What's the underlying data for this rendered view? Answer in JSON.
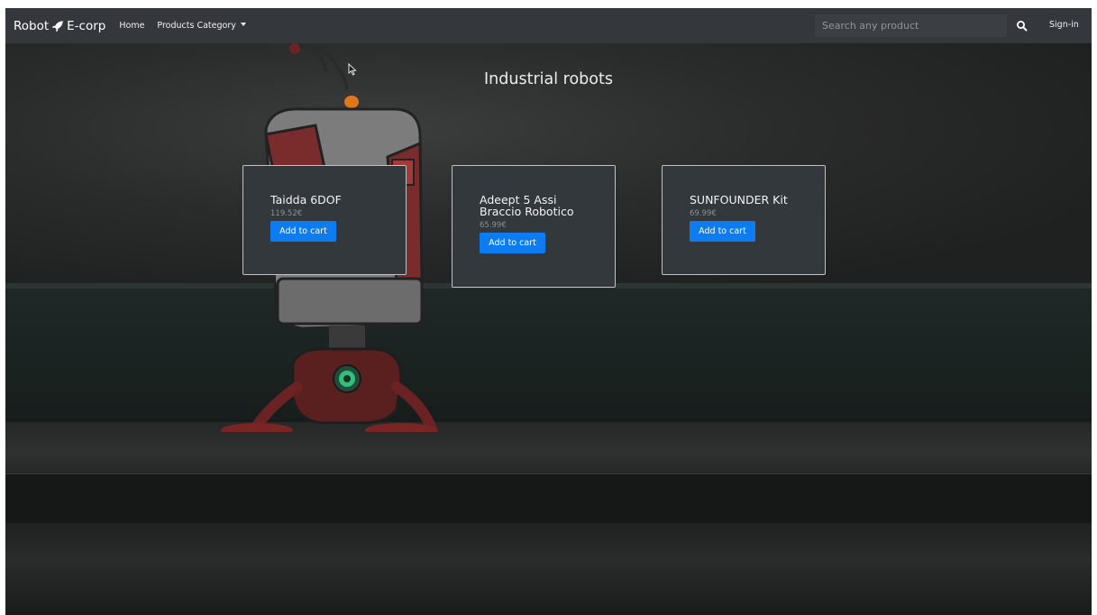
{
  "navbar": {
    "brand_left": "Robot",
    "brand_right": "E-corp",
    "brand_icon": "rocket-icon",
    "links": [
      "Home",
      "Products Category"
    ],
    "search_placeholder": "Search any product",
    "search_icon": "search-icon",
    "signin": "Sign-in"
  },
  "page": {
    "heading": "Industrial robots"
  },
  "products": [
    {
      "name": "Taidda 6DOF",
      "price": "119.52€",
      "button": "Add to cart"
    },
    {
      "name": "Adeept 5 Assi Braccio Robotico",
      "name_line1": "Adeept 5 Assi",
      "name_line2": "Braccio Robotico",
      "price": "65.99€",
      "button": "Add to cart"
    },
    {
      "name": "SUNFOUNDER Kit",
      "price": "69.99€",
      "button": "Add to cart"
    }
  ],
  "colors": {
    "navbar": "#34383c",
    "card": "#33383d",
    "button": "#0d7cf0",
    "background": "#1c1d1d"
  }
}
